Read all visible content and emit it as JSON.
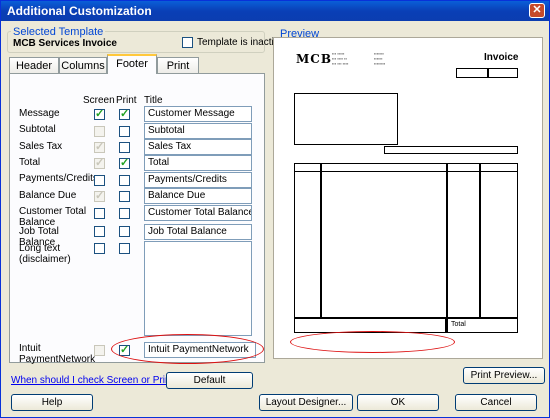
{
  "window": {
    "title": "Additional Customization",
    "close_symbol": "✕"
  },
  "template": {
    "group_label": "Selected Template",
    "name": "MCB Services Invoice",
    "inactive_label": "Template is inactive"
  },
  "tabs": [
    {
      "label": "Header"
    },
    {
      "label": "Columns"
    },
    {
      "label": "Footer"
    },
    {
      "label": "Print"
    }
  ],
  "columns": {
    "screen": "Screen",
    "print": "Print",
    "title": "Title"
  },
  "rows": [
    {
      "label": "Message",
      "screen": true,
      "screen_disabled": false,
      "print": true,
      "print_disabled": false,
      "title": "Customer Message"
    },
    {
      "label": "Subtotal",
      "screen": false,
      "screen_disabled": true,
      "print": false,
      "print_disabled": false,
      "title": "Subtotal"
    },
    {
      "label": "Sales Tax",
      "screen": true,
      "screen_disabled": true,
      "print": false,
      "print_disabled": false,
      "title": "Sales Tax"
    },
    {
      "label": "Total",
      "screen": true,
      "screen_disabled": true,
      "print": true,
      "print_disabled": false,
      "title": "Total"
    },
    {
      "label": "Payments/Credits",
      "screen": false,
      "screen_disabled": false,
      "print": false,
      "print_disabled": false,
      "title": "Payments/Credits"
    },
    {
      "label": "Balance Due",
      "screen": true,
      "screen_disabled": true,
      "print": false,
      "print_disabled": false,
      "title": "Balance Due"
    },
    {
      "label": "Customer Total Balance",
      "screen": false,
      "screen_disabled": false,
      "print": false,
      "print_disabled": false,
      "title": "Customer Total Balance"
    },
    {
      "label": "Job Total Balance",
      "screen": false,
      "screen_disabled": false,
      "print": false,
      "print_disabled": false,
      "title": "Job Total Balance"
    },
    {
      "label": "Long text (disclaimer)",
      "screen": false,
      "screen_disabled": false,
      "print": false,
      "print_disabled": false,
      "title": ""
    },
    {
      "label": "Intuit PaymentNetwork",
      "screen": false,
      "screen_disabled": true,
      "print": true,
      "print_disabled": false,
      "title": "Intuit PaymentNetwork"
    }
  ],
  "check_mark": "✓",
  "links": {
    "screen_or_print": "When should I check Screen or Print?"
  },
  "buttons": {
    "default": "Default",
    "print_preview": "Print Preview...",
    "help": "Help",
    "layout_designer": "Layout Designer...",
    "ok": "OK",
    "cancel": "Cancel"
  },
  "preview": {
    "label": "Preview",
    "logo": "MCB",
    "invoice_title": "Invoice",
    "total_label": "Total"
  },
  "colors": {
    "highlight_oval": "#dd1111",
    "group_label": "#0046d5",
    "title_bar": "#0a3fb6"
  }
}
